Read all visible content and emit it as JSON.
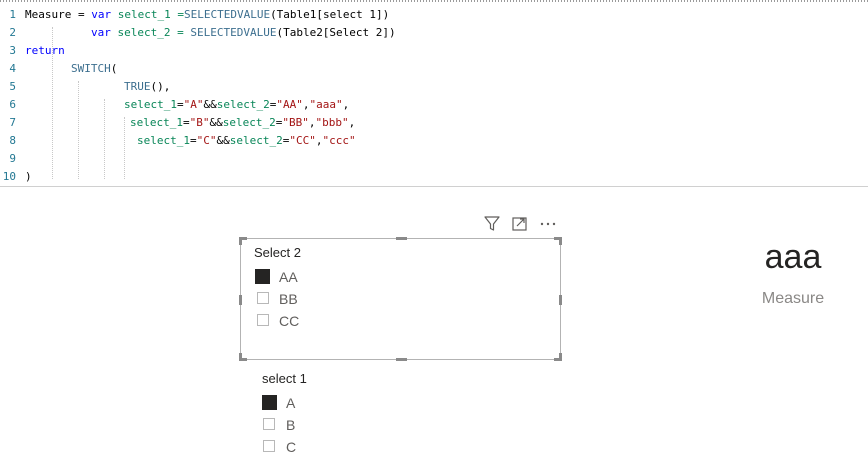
{
  "editor": {
    "lines": [
      {
        "num": "1",
        "tokens": [
          [
            "Measure = ",
            "t"
          ],
          [
            "var",
            "kw"
          ],
          [
            " select_1 =",
            "var"
          ],
          [
            "SELECTEDVALUE",
            "fn"
          ],
          [
            "(Table1[select 1])",
            "t"
          ]
        ]
      },
      {
        "num": "2",
        "tokens": [
          [
            "var",
            "kw"
          ],
          [
            " select_2 = ",
            "var"
          ],
          [
            "SELECTEDVALUE",
            "fn"
          ],
          [
            "(Table2[Select 2])",
            "t"
          ]
        ]
      },
      {
        "num": "3",
        "tokens": [
          [
            "return",
            "kw"
          ]
        ]
      },
      {
        "num": "4",
        "tokens": [
          [
            "SWITCH",
            "fn"
          ],
          [
            "(",
            "t"
          ]
        ]
      },
      {
        "num": "5",
        "tokens": [
          [
            "TRUE",
            "fn"
          ],
          [
            "(),",
            "t"
          ]
        ]
      },
      {
        "num": "6",
        "tokens": [
          [
            "select_1",
            "var"
          ],
          [
            "=",
            "t"
          ],
          [
            "\"A\"",
            "str"
          ],
          [
            "&&",
            "t"
          ],
          [
            "select_2",
            "var"
          ],
          [
            "=",
            "t"
          ],
          [
            "\"AA\"",
            "str"
          ],
          [
            ",",
            "t"
          ],
          [
            "\"aaa\"",
            "str"
          ],
          [
            ",",
            "t"
          ]
        ]
      },
      {
        "num": "7",
        "tokens": [
          [
            "select_1",
            "var"
          ],
          [
            "=",
            "t"
          ],
          [
            "\"B\"",
            "str"
          ],
          [
            "&&",
            "t"
          ],
          [
            "select_2",
            "var"
          ],
          [
            "=",
            "t"
          ],
          [
            "\"BB\"",
            "str"
          ],
          [
            ",",
            "t"
          ],
          [
            "\"bbb\"",
            "str"
          ],
          [
            ",",
            "t"
          ]
        ]
      },
      {
        "num": "8",
        "tokens": [
          [
            "select_1",
            "var"
          ],
          [
            "=",
            "t"
          ],
          [
            "\"C\"",
            "str"
          ],
          [
            "&&",
            "t"
          ],
          [
            "select_2",
            "var"
          ],
          [
            "=",
            "t"
          ],
          [
            "\"CC\"",
            "str"
          ],
          [
            ",",
            "t"
          ],
          [
            "\"ccc\"",
            "str"
          ]
        ]
      },
      {
        "num": "9",
        "tokens": []
      },
      {
        "num": "10",
        "tokens": [
          [
            ")",
            "t"
          ]
        ]
      }
    ]
  },
  "visual_header": {
    "icons": [
      "filter-icon",
      "focus-mode-icon",
      "more-options-icon"
    ]
  },
  "slicer2": {
    "title": "Select 2",
    "items": [
      {
        "label": "AA",
        "checked": true
      },
      {
        "label": "BB",
        "checked": false
      },
      {
        "label": "CC",
        "checked": false
      }
    ]
  },
  "slicer1": {
    "title": "select 1",
    "items": [
      {
        "label": "A",
        "checked": true
      },
      {
        "label": "B",
        "checked": false
      },
      {
        "label": "C",
        "checked": false
      }
    ]
  },
  "card": {
    "value": "aaa",
    "label": "Measure"
  },
  "colors": {
    "keyword": "#0000ff",
    "variable": "#098658",
    "function": "#3d6f8f",
    "string": "#a31515",
    "line_number": "#237893"
  }
}
